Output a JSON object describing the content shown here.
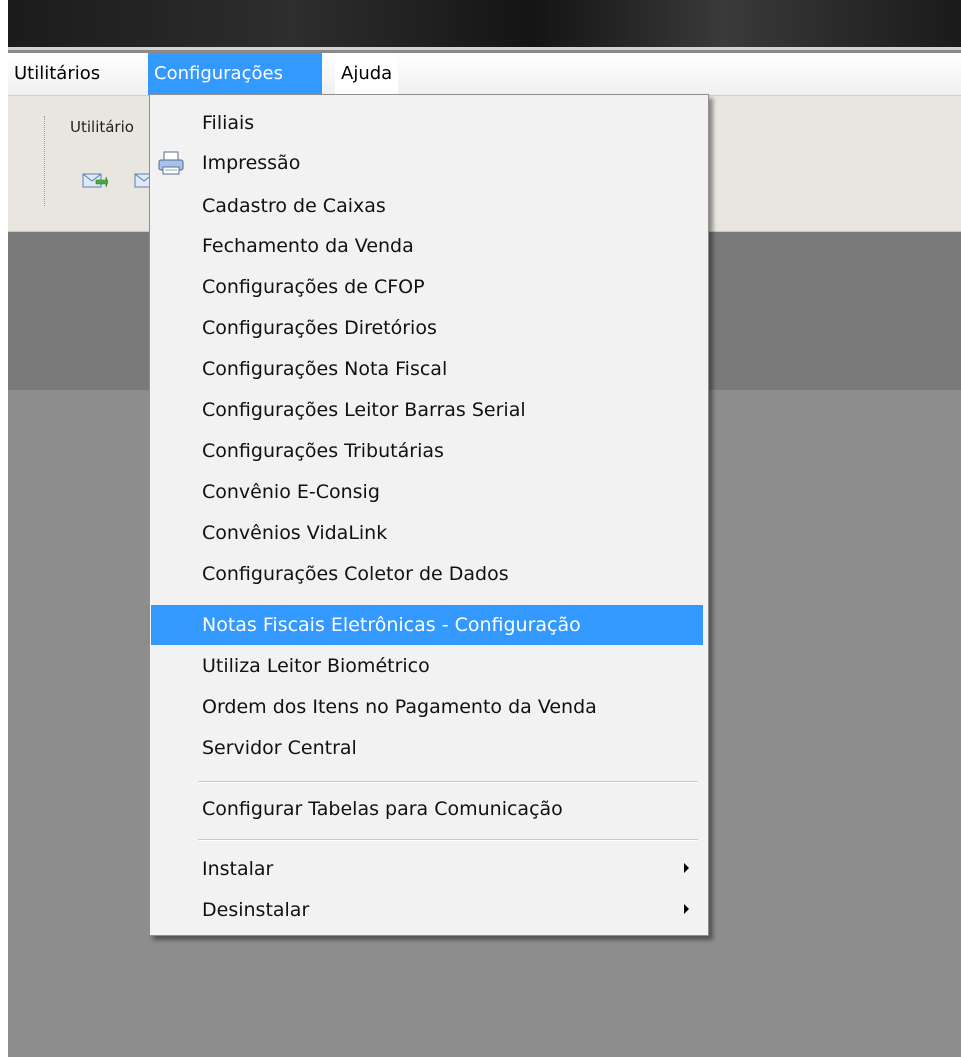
{
  "menubar": {
    "items": [
      {
        "label": "Utilitários",
        "active": false
      },
      {
        "label": "Configurações",
        "active": true
      },
      {
        "label": "Ajuda",
        "active": false
      }
    ]
  },
  "toolbar": {
    "group_label": "Utilitário"
  },
  "menu": {
    "items": [
      {
        "label": "Filiais",
        "icon": null
      },
      {
        "label": "Impressão",
        "icon": "printer-icon"
      },
      {
        "label": "Cadastro de Caixas"
      },
      {
        "label": "Fechamento da Venda"
      },
      {
        "label": "Configurações de CFOP"
      },
      {
        "label": "Configurações Diretórios"
      },
      {
        "label": "Configurações Nota Fiscal"
      },
      {
        "label": "Configurações Leitor Barras Serial"
      },
      {
        "label": "Configurações Tributárias"
      },
      {
        "label": "Convênio E-Consig"
      },
      {
        "label": "Convênios VidaLink"
      },
      {
        "label": "Configurações Coletor de Dados"
      },
      {
        "label": "Notas Fiscais Eletrônicas - Configuração",
        "selected": true
      },
      {
        "label": "Utiliza Leitor Biométrico"
      },
      {
        "label": "Ordem dos Itens no Pagamento da Venda"
      },
      {
        "label": "Servidor Central"
      }
    ],
    "group2": [
      {
        "label": "Configurar Tabelas para Comunicação"
      }
    ],
    "submenus": [
      {
        "label": "Instalar",
        "has_submenu": true
      },
      {
        "label": "Desinstalar",
        "has_submenu": true
      }
    ]
  },
  "colors": {
    "highlight": "#3399ff",
    "menu_bg": "#f2f2f2",
    "workspace": "#8d8d8d"
  }
}
